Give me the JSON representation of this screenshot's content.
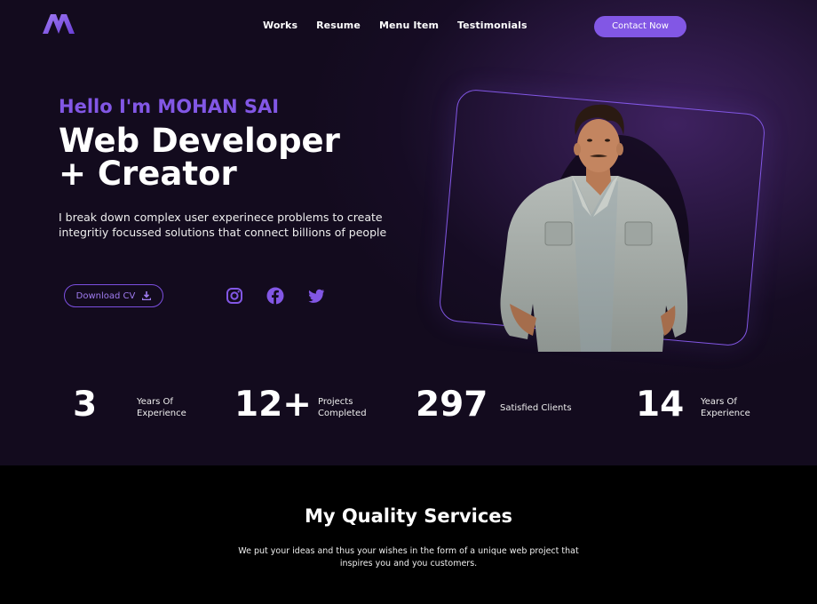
{
  "colors": {
    "accent": "#8257e5",
    "hero_bg": "#130b1e",
    "services_bg": "#000000"
  },
  "header": {
    "logo_icon": "m-logo-icon",
    "nav": [
      {
        "label": "Works"
      },
      {
        "label": "Resume"
      },
      {
        "label": "Menu Item"
      },
      {
        "label": "Testimonials"
      }
    ],
    "cta_label": "Contact Now"
  },
  "hero": {
    "greeting": "Hello I'm MOHAN SAI",
    "headline_line1": "Web Developer",
    "headline_line2": "+ Creator",
    "description": "I break down complex user experinece problems to create integritiy focussed solutions that connect billions of people",
    "download_label": "Download CV",
    "download_icon": "download-icon",
    "socials": [
      {
        "name": "instagram-icon"
      },
      {
        "name": "facebook-icon"
      },
      {
        "name": "twitter-icon"
      }
    ]
  },
  "stats": [
    {
      "value": "3",
      "label_line1": "Years Of",
      "label_line2": "Experience"
    },
    {
      "value": "12+",
      "label_line1": "Projects",
      "label_line2": "Completed"
    },
    {
      "value": "297",
      "label_line1": "Satisfied Clients",
      "label_line2": ""
    },
    {
      "value": "14",
      "label_line1": "Years Of",
      "label_line2": "Experience"
    }
  ],
  "services": {
    "title": "My Quality Services",
    "description_line1": "We put your ideas and thus your wishes in the form of a unique web project that",
    "description_line2": "inspires you and you customers."
  }
}
